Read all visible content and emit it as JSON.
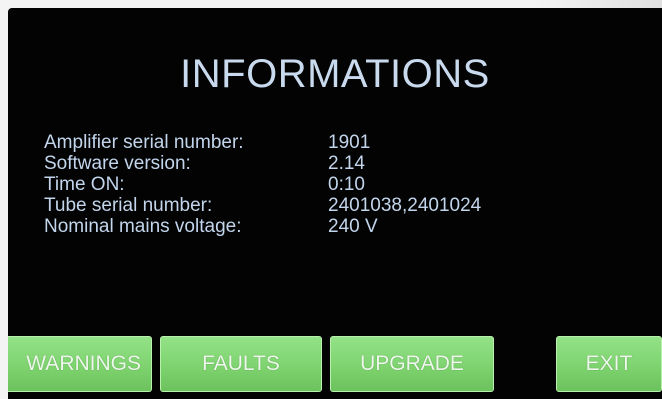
{
  "title": "INFORMATIONS",
  "info": [
    {
      "label": "Amplifier serial number:",
      "value": "1901"
    },
    {
      "label": "Software version:",
      "value": "2.14"
    },
    {
      "label": "Time ON:",
      "value": "0:10"
    },
    {
      "label": "Tube serial number:",
      "value": "2401038,2401024"
    },
    {
      "label": "Nominal mains voltage:",
      "value": "240  V"
    }
  ],
  "buttons": {
    "warnings": "WARNINGS",
    "faults": "FAULTS",
    "upgrade": "UPGRADE",
    "exit": "EXIT"
  },
  "colors": {
    "screen_background": "#030303",
    "text": "#c2d5ec",
    "button_green": "#7ed36f"
  }
}
